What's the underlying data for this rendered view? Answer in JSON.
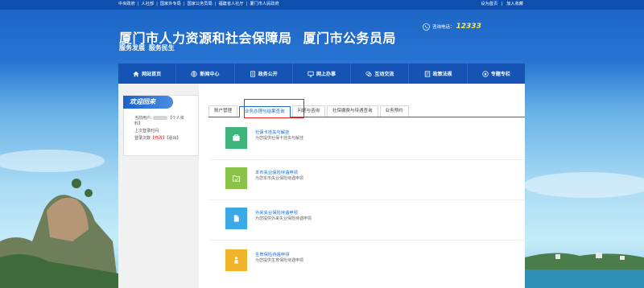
{
  "top_links": [
    "中央政府",
    "人社部",
    "国家外专局",
    "国家公务员局",
    "福建省人社厅",
    "厦门市人民政府"
  ],
  "top_right": {
    "homepage": "设为首页",
    "favorite": "加入收藏"
  },
  "header": {
    "title_1": "厦门市人力资源和社会保障局",
    "title_2": "厦门市公务员局",
    "slogan": "服务发展  服务民生",
    "hotline_label": "咨询电话：",
    "hotline_number": "12333"
  },
  "nav": [
    {
      "label": "网站首页",
      "icon": "home-icon"
    },
    {
      "label": "新闻中心",
      "icon": "news-icon"
    },
    {
      "label": "政务公开",
      "icon": "document-icon"
    },
    {
      "label": "网上办事",
      "icon": "monitor-icon"
    },
    {
      "label": "互动交流",
      "icon": "chat-icon"
    },
    {
      "label": "政策法规",
      "icon": "book-icon"
    },
    {
      "label": "专题专栏",
      "icon": "star-icon"
    }
  ],
  "welcome": {
    "heading": "欢迎回来",
    "current_user_prefix": "当前用户:",
    "current_user_suffix": "【个人资",
    "current_user_suffix_2": "料】",
    "last_login": "上次登录时间:",
    "login_count_prefix": "登录次数",
    "change_password": "【修改】",
    "logout": "【退出】"
  },
  "tabs": [
    {
      "label": "账户管理",
      "active": false
    },
    {
      "label": "业务办理与结果查询",
      "active": true
    },
    {
      "label": "问题与咨询",
      "active": false
    },
    {
      "label": "社保缴费与待遇查询",
      "active": false
    },
    {
      "label": "业务预约",
      "active": false
    }
  ],
  "services": [
    {
      "title": "社保卡挂失与解挂",
      "desc": "为您提供社保卡挂失与解挂",
      "color": "#3fb57d",
      "icon": "card-icon"
    },
    {
      "title": "本市失业保险待遇申领",
      "desc": "为您本市失业保险待遇申领",
      "color": "#8bc34a",
      "icon": "folder-icon"
    },
    {
      "title": "外来失业保险待遇申领",
      "desc": "为您提供外来失业保险待遇申领",
      "color": "#3ba9e6",
      "icon": "file-icon"
    },
    {
      "title": "生育保险待遇申领",
      "desc": "为您提供生育保险待遇申领",
      "color": "#f2b42a",
      "icon": "baby-icon"
    }
  ],
  "colors": {
    "nav_bg": "#1553b5",
    "accent": "#1b6fd0",
    "highlight": "#e02020",
    "hotline": "#ffe640"
  }
}
